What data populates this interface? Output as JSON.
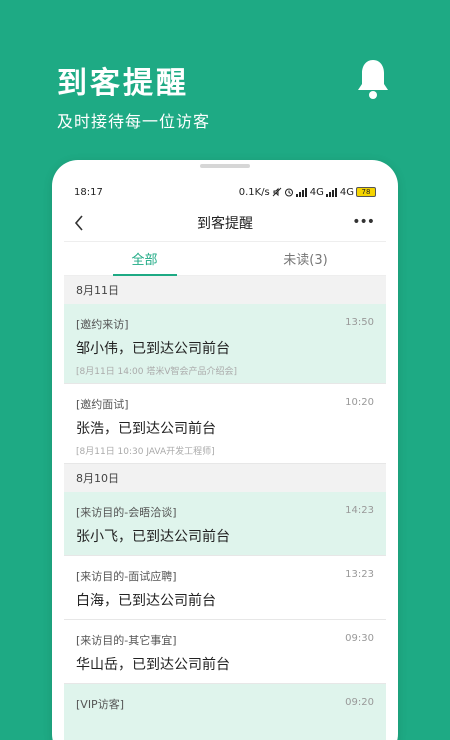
{
  "promo": {
    "title": "到客提醒",
    "subtitle": "及时接待每一位访客"
  },
  "status_bar": {
    "time": "18:17",
    "speed": "0.1K/s",
    "network1": "4G",
    "network2": "4G",
    "battery": "78"
  },
  "nav": {
    "title": "到客提醒",
    "more": "•••"
  },
  "tabs": [
    {
      "label": "全部",
      "active": true
    },
    {
      "label": "未读(3)",
      "active": false
    }
  ],
  "groups": [
    {
      "date": "8月11日",
      "items": [
        {
          "tag": "[邀约来访]",
          "time": "13:50",
          "name": "邹小伟，已到达公司前台",
          "sub": "[8月11日 14:00 塔米V智会产品介绍会]",
          "highlighted": true
        },
        {
          "tag": "[邀约面试]",
          "time": "10:20",
          "name": "张浩，已到达公司前台",
          "sub": "[8月11日 10:30 JAVA开发工程师]",
          "highlighted": false
        }
      ]
    },
    {
      "date": "8月10日",
      "items": [
        {
          "tag": "[来访目的-会晤洽谈]",
          "time": "14:23",
          "name": "张小飞，已到达公司前台",
          "highlighted": true
        },
        {
          "tag": "[来访目的-面试应聘]",
          "time": "13:23",
          "name": "白海，已到达公司前台",
          "highlighted": false
        },
        {
          "tag": "[来访目的-其它事宜]",
          "time": "09:30",
          "name": "华山岳，已到达公司前台",
          "highlighted": false
        },
        {
          "tag": "[VIP访客]",
          "time": "09:20",
          "highlighted": true
        }
      ]
    }
  ],
  "colors": {
    "brand": "#1eaa84",
    "highlight_row": "#dff4ec"
  }
}
